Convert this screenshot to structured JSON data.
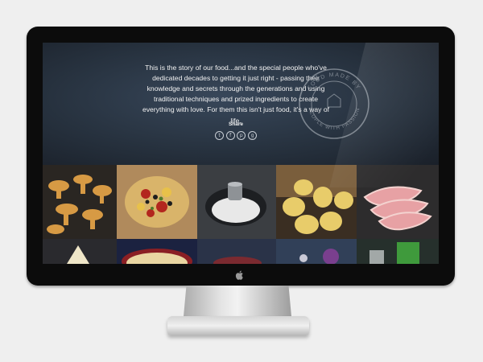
{
  "page": {
    "story_text": "This is the story of our food...and the special people who've dedicated decades to getting it just right - passing their knowledge and secrets through the generations and using traditional techniques and prized ingredients to create everything with love. For them this isn't just food, it's a way of life.",
    "share_label": "Share",
    "share_icons": [
      "twitter-icon",
      "facebook-icon",
      "pinterest-icon",
      "google-plus-icon"
    ],
    "stamp_text": {
      "top": "FOOD MADE BY",
      "bottom": "PEOPLE WITH PASSION"
    }
  },
  "colors": {
    "hero_background": "#27323f",
    "text": "#f2f2f2",
    "monitor_bezel": "#0c0c0c"
  },
  "photo_tiles": [
    "mushrooms",
    "baked-vegetables",
    "salt-bowl",
    "potatoes",
    "ham-slices",
    "cheese",
    "tart",
    "dark-food",
    "blue-bowl",
    "flowers",
    "green-bottle"
  ]
}
